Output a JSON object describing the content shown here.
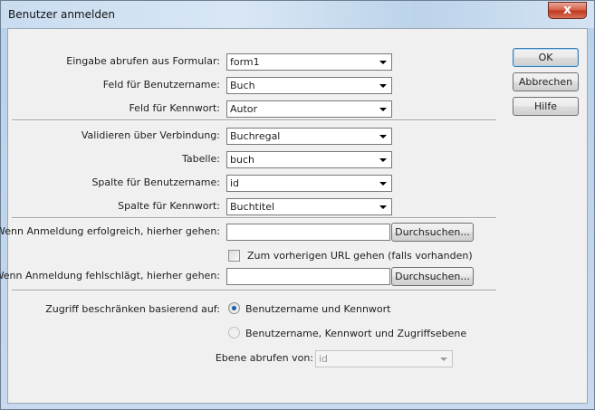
{
  "window": {
    "title": "Benutzer anmelden",
    "close_glyph": "x"
  },
  "form": {
    "get_from_form": {
      "label": "Eingabe abrufen aus Formular:",
      "value": "form1"
    },
    "username_field": {
      "label": "Feld für Benutzername:",
      "value": "Buch"
    },
    "password_field": {
      "label": "Feld für Kennwort:",
      "value": "Autor"
    },
    "validate_connection": {
      "label": "Validieren über Verbindung:",
      "value": "Buchregal"
    },
    "table": {
      "label": "Tabelle:",
      "value": "buch"
    },
    "username_column": {
      "label": "Spalte für Benutzername:",
      "value": "id"
    },
    "password_column": {
      "label": "Spalte für Kennwort:",
      "value": "Buchtitel"
    },
    "success_redirect": {
      "label": "Wenn Anmeldung erfolgreich, hierher gehen:",
      "value": "",
      "browse_label": "Durchsuchen..."
    },
    "previous_url": {
      "label": "Zum vorherigen URL gehen (falls vorhanden)",
      "checked": false
    },
    "failure_redirect": {
      "label": "Wenn Anmeldung fehlschlägt, hierher gehen:",
      "value": "",
      "browse_label": "Durchsuchen..."
    },
    "restrict": {
      "label": "Zugriff beschränken basierend auf:",
      "option1": "Benutzername und Kennwort",
      "option2": "Benutzername, Kennwort und Zugriffsebene",
      "selected": "option1"
    },
    "level": {
      "label": "Ebene abrufen von:",
      "value": "id",
      "disabled": true
    }
  },
  "buttons": {
    "ok": "OK",
    "cancel": "Abbrechen",
    "help": "Hilfe"
  }
}
